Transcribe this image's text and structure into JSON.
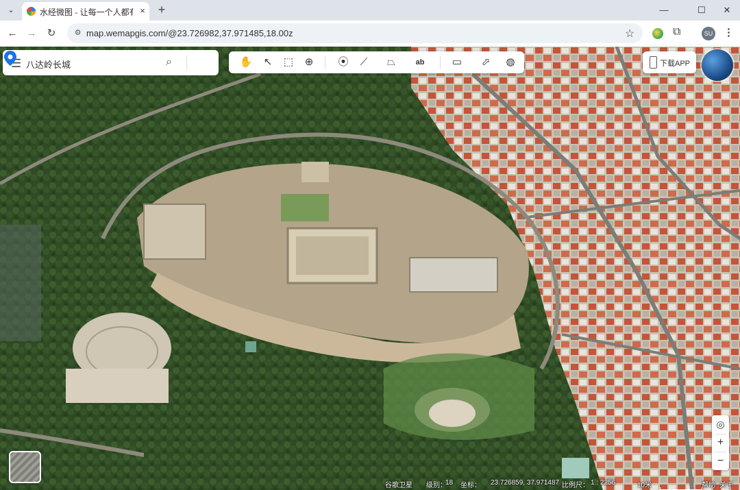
{
  "browser": {
    "tab_title": "水经微图 - 让每一个人都有自己",
    "tab_close": "×",
    "new_tab": "+",
    "url": "map.wemapgis.com/@23.726982,37.971485,18.00z",
    "profile_initials": "SU",
    "window_controls": {
      "minimize": "—",
      "maximize": "☐",
      "close": "✕"
    }
  },
  "search": {
    "query": "八达岭长城"
  },
  "toolbar_icons": [
    "hand-pan-icon",
    "pointer-icon",
    "select-icon",
    "zoom-extent-icon",
    "marker-icon",
    "polyline-icon",
    "polygon-icon",
    "text-label-icon",
    "ruler-icon",
    "identify-icon",
    "globe-icon"
  ],
  "toolbar_text_label": "ab",
  "download_app": {
    "label": "下载APP"
  },
  "zoom": {
    "plus": "+",
    "minus": "−"
  },
  "status": {
    "source": "谷歌卫星",
    "level_label": "级别：",
    "level": "18",
    "coord_label": "坐标：",
    "coords": "23.726859, 37.971487",
    "scale_label": "比例尺：",
    "scale": "1 : 2256",
    "scale_bar": "10米",
    "help": "帮助",
    "about": "关于"
  },
  "colors": {
    "accent_blue": "#1a73e8",
    "tab_bg": "#dee3ea"
  }
}
